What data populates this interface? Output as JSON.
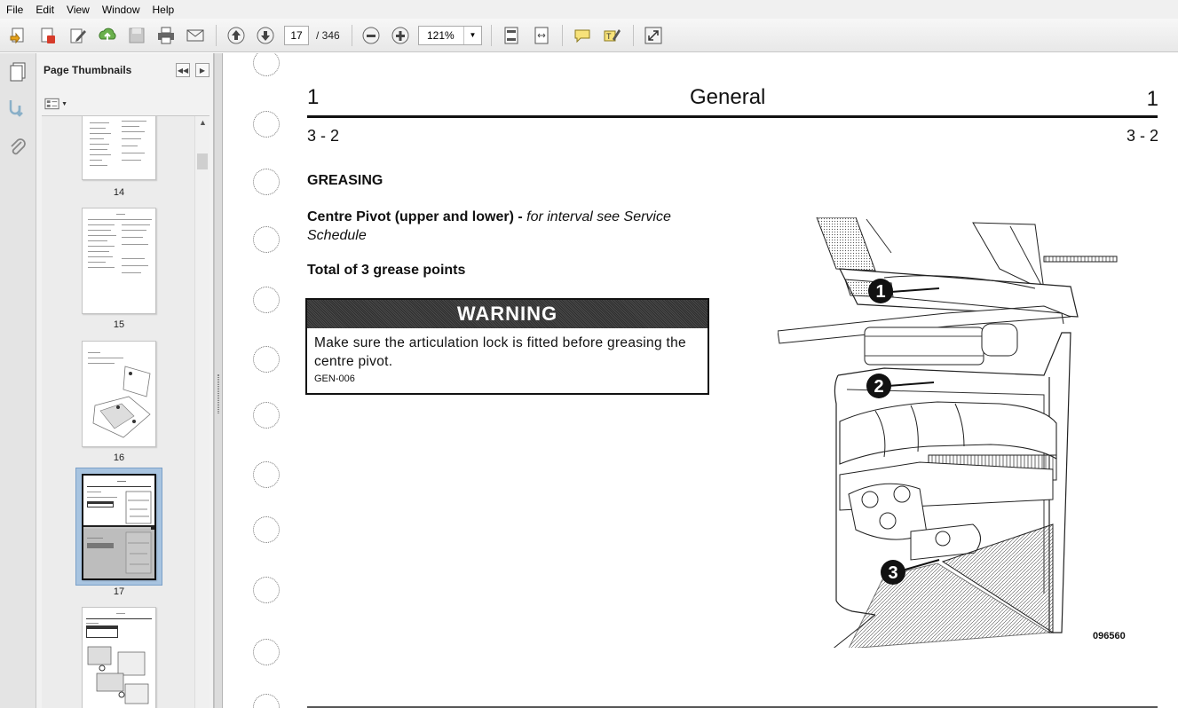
{
  "menu": [
    "File",
    "Edit",
    "View",
    "Window",
    "Help"
  ],
  "toolbar": {
    "current_page": "17",
    "total_pages": "/ 346",
    "zoom": "121%",
    "icons": [
      "create-pdf-icon",
      "create-pdf-red-icon",
      "edit-icon",
      "upload-icon",
      "save-icon",
      "print-icon",
      "email-icon",
      "previous-page-icon",
      "next-page-icon",
      "zoom-out-icon",
      "zoom-in-icon",
      "fit-page-icon",
      "fit-width-icon",
      "comment-icon",
      "highlight-icon",
      "expand-icon"
    ]
  },
  "sidebar": {
    "title": "Page Thumbnails",
    "thumbnails": [
      {
        "label": "14"
      },
      {
        "label": "15"
      },
      {
        "label": "16"
      },
      {
        "label": "17"
      },
      {
        "label": ""
      }
    ]
  },
  "document": {
    "chapter_left": "1",
    "title": "General",
    "chapter_right": "1",
    "section_left": "3 - 2",
    "section_right": "3 - 2",
    "heading": "GREASING",
    "pivot_bold": "Centre Pivot (upper and lower) -",
    "pivot_italic": " for interval see Service Schedule",
    "grease_points": "Total of 3 grease points",
    "warning_title": "WARNING",
    "warning_text": "Make sure the articulation lock is fitted before greasing the centre pivot.",
    "warning_code": "GEN-006",
    "figure_callouts": [
      "1",
      "2",
      "3"
    ],
    "figure_code": "096560"
  },
  "colors": {
    "toolbar_bg": "#ececec",
    "selection": "#a8c4e0",
    "text": "#111111"
  }
}
